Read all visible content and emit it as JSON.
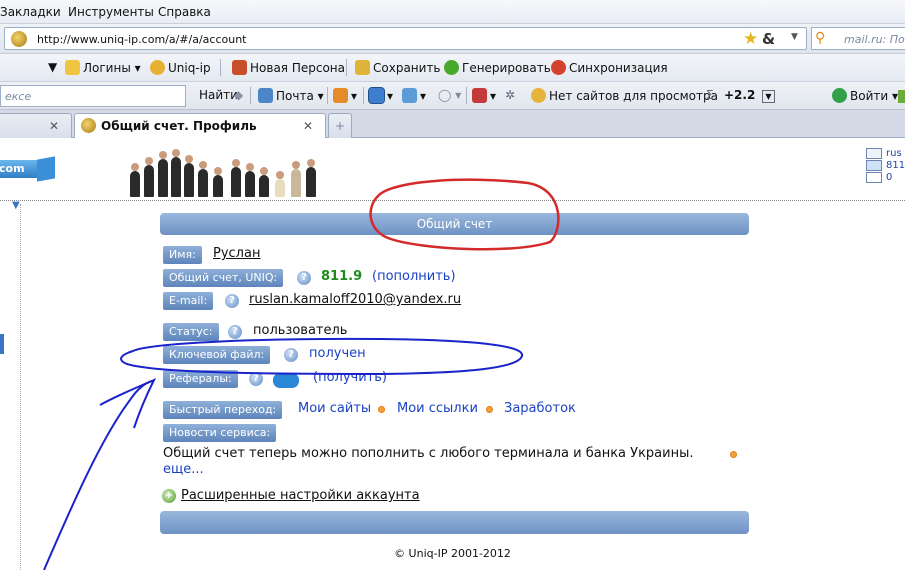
{
  "menu": [
    "Закладки",
    "Инструменты",
    "Справка"
  ],
  "address": {
    "url": "http://www.uniq-ip.com/a/#/a/account",
    "search_placeholder": "mail.ru: По"
  },
  "toolbar": {
    "logins": "Логины",
    "uniqip": "Uniq-ip",
    "new_persona": "Новая Персона",
    "save": "Сохранить",
    "generate": "Генерировать",
    "sync": "Синхронизация"
  },
  "toolbar2": {
    "search_text": "екce",
    "find": "Найти",
    "mail": "Почта",
    "no_sites": "Нет сайтов для просмотра",
    "sum": "+2.2",
    "login": "Войти"
  },
  "tabs": {
    "active_title": "Общий счет. Профиль"
  },
  "header": {
    "logo_text": "com",
    "user_name_short": "rus",
    "number_short": "811",
    "messages": "0"
  },
  "account": {
    "title": "Общий счет",
    "name_label": "Имя:",
    "name_value": "Руслан",
    "balance_label": "Общий счет, UNIQ:",
    "balance_value": "811.9",
    "topup_text": "(пополнить)",
    "email_label": "E-mail:",
    "email_value": "ruslan.kamaloff2010@yandex.ru",
    "status_label": "Статус:",
    "status_value": "пользователь",
    "keyfile_label": "Ключевой файл:",
    "keyfile_value": "получен",
    "referrals_label": "Рефералы:",
    "referrals_action": "(получить)",
    "quick_label": "Быстрый переход:",
    "quick_links": [
      "Мои сайты",
      "Мои ссылки",
      "Заработок"
    ],
    "news_label": "Новости сервиса:",
    "news_text": "Общий счет теперь можно пополнить с любого терминала и банка Украины.",
    "news_more": "еще...",
    "advanced_settings": "Расширенные настройки аккаунта"
  },
  "footer": {
    "copyright": "© Uniq-IP 2001-2012"
  },
  "colors": {
    "bar": "#7a9dcc",
    "annotation_red": "#d32a2a",
    "annotation_blue": "#1a23c9"
  }
}
